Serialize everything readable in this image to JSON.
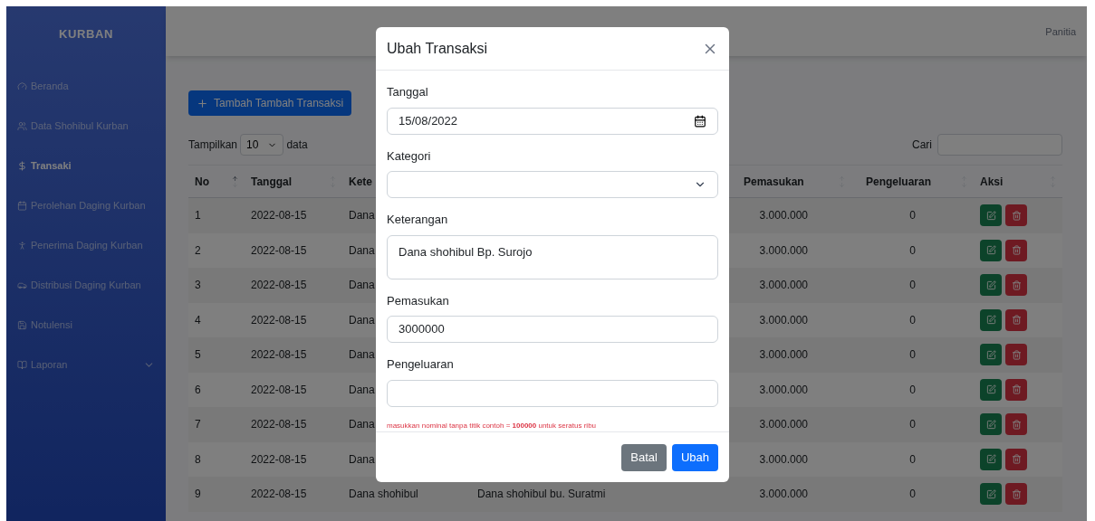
{
  "sidebar": {
    "brand": "KURBAN",
    "items": [
      {
        "label": "Beranda",
        "kind": "link",
        "selected": false
      },
      {
        "label": "Data Shohibul Kurban",
        "kind": "link",
        "selected": false
      },
      {
        "label": "Transaki",
        "kind": "link",
        "selected": true
      },
      {
        "label": "Perolehan Daging Kurban",
        "kind": "link",
        "selected": false
      },
      {
        "label": "Penerima Daging Kurban",
        "kind": "link",
        "selected": false
      },
      {
        "label": "Distribusi Daging Kurban",
        "kind": "link",
        "selected": false
      },
      {
        "label": "Notulensi",
        "kind": "link",
        "selected": false
      },
      {
        "label": "Laporan",
        "kind": "dropdown",
        "selected": false
      }
    ]
  },
  "topbar": {
    "user": "Panitia"
  },
  "content": {
    "add_button": "Tambah Tambah Transaksi",
    "length": {
      "prefix": "Tampilkan",
      "value": "10",
      "suffix": "data"
    },
    "search": {
      "label": "Cari"
    },
    "table": {
      "columns": [
        {
          "label": "No",
          "sorted": true
        },
        {
          "label": "Tanggal",
          "sorted": false
        },
        {
          "label": "Kete"
        },
        {
          "label": "Pemasukan",
          "sorted": false
        },
        {
          "label": "Pengeluaran",
          "sorted": false
        },
        {
          "label": "Aksi",
          "sorted": false
        }
      ],
      "rows": [
        {
          "no": "1",
          "date": "2022-08-15",
          "column_3": "Dana",
          "income": "3.000.000",
          "expense": "0"
        },
        {
          "no": "2",
          "date": "2022-08-15",
          "column_3": "Dana",
          "income": "3.000.000",
          "expense": "0"
        },
        {
          "no": "3",
          "date": "2022-08-15",
          "column_3": "Dana",
          "income": "3.000.000",
          "expense": "0"
        },
        {
          "no": "4",
          "date": "2022-08-15",
          "column_3": "Dana",
          "income": "3.000.000",
          "expense": "0"
        },
        {
          "no": "5",
          "date": "2022-08-15",
          "column_3": "Dana",
          "income": "3.000.000",
          "expense": "0"
        },
        {
          "no": "6",
          "date": "2022-08-15",
          "column_3": "Dana",
          "income": "3.000.000",
          "expense": "0"
        },
        {
          "no": "7",
          "date": "2022-08-15",
          "column_3": "Dana",
          "income": "3.000.000",
          "expense": "0"
        },
        {
          "no": "8",
          "date": "2022-08-15",
          "column_3": "Dana",
          "income": "3.000.000",
          "expense": "0"
        },
        {
          "no": "9",
          "date": "2022-08-15",
          "column_3": "Dana shohibul",
          "column_4": "Dana shohibul bu. Suratmi",
          "income": "3.000.000",
          "expense": "0"
        }
      ]
    }
  },
  "modal": {
    "title": "Ubah Transaksi",
    "fields": [
      {
        "label": "Tanggal",
        "kind": "date",
        "value": "15/08/2022"
      },
      {
        "label": "Kategori",
        "kind": "select"
      },
      {
        "label": "Keterangan",
        "kind": "textarea",
        "value": "Dana shohibul Bp. Surojo"
      },
      {
        "label": "Pemasukan",
        "kind": "text",
        "value": "3000000"
      },
      {
        "label": "Pengeluaran",
        "kind": "text"
      }
    ],
    "hint": "masukkan nominal tanpa titik contoh = **100000** untuk seratus ribu",
    "buttons": [
      {
        "label": "Batal",
        "kind": "secondary"
      },
      {
        "label": "Ubah",
        "kind": "primary"
      }
    ]
  }
}
